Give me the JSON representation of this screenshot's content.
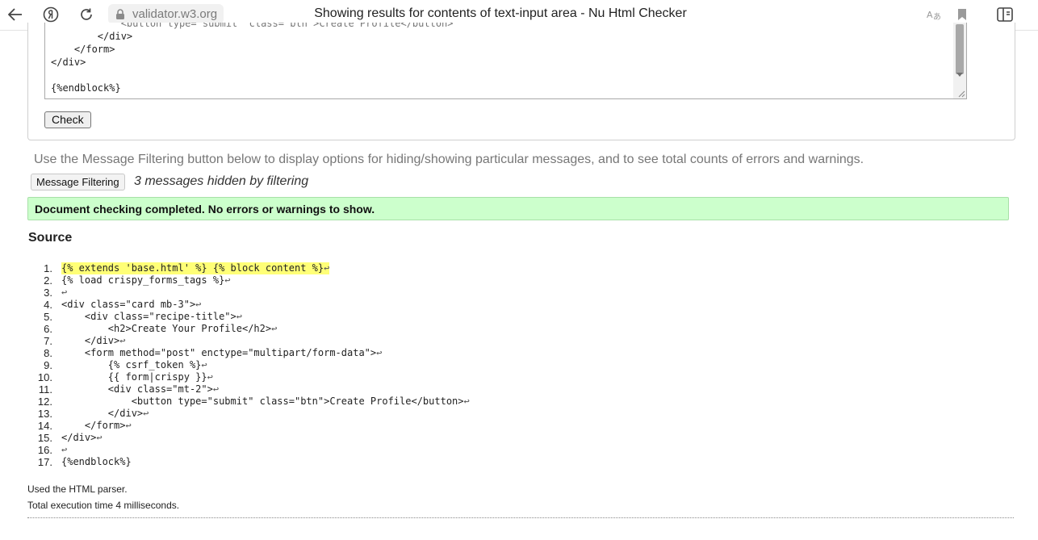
{
  "browser": {
    "url": "validator.w3.org",
    "title": "Showing results for contents of text-input area - Nu Html Checker"
  },
  "textarea": {
    "lines": [
      "            <button type=\"submit\" class=\"btn\">Create Profile</button>",
      "        </div>",
      "    </form>",
      "</div>",
      "",
      "{%endblock%}"
    ]
  },
  "form": {
    "check_label": "Check"
  },
  "filtering": {
    "hint": "Use the Message Filtering button below to display options for hiding/showing particular messages, and to see total counts of errors and warnings.",
    "button_label": "Message Filtering",
    "hidden_count": "3 messages hidden by filtering"
  },
  "result": {
    "message": "Document checking completed. No errors or warnings to show."
  },
  "source": {
    "heading": "Source",
    "lines": [
      {
        "num": "1.",
        "code": "{% extends 'base.html' %} {% block content %}",
        "highlight": true
      },
      {
        "num": "2.",
        "code": "{% load crispy_forms_tags %}",
        "highlight": false
      },
      {
        "num": "3.",
        "code": "",
        "highlight": false
      },
      {
        "num": "4.",
        "code": "<div class=\"card mb-3\">",
        "highlight": false
      },
      {
        "num": "5.",
        "code": "    <div class=\"recipe-title\">",
        "highlight": false
      },
      {
        "num": "6.",
        "code": "        <h2>Create Your Profile</h2>",
        "highlight": false
      },
      {
        "num": "7.",
        "code": "    </div>",
        "highlight": false
      },
      {
        "num": "8.",
        "code": "    <form method=\"post\" enctype=\"multipart/form-data\">",
        "highlight": false
      },
      {
        "num": "9.",
        "code": "        {% csrf_token %}",
        "highlight": false
      },
      {
        "num": "10.",
        "code": "        {{ form|crispy }}",
        "highlight": false
      },
      {
        "num": "11.",
        "code": "        <div class=\"mt-2\">",
        "highlight": false
      },
      {
        "num": "12.",
        "code": "            <button type=\"submit\" class=\"btn\">Create Profile</button>",
        "highlight": false
      },
      {
        "num": "13.",
        "code": "        </div>",
        "highlight": false
      },
      {
        "num": "14.",
        "code": "    </form>",
        "highlight": false
      },
      {
        "num": "15.",
        "code": "</div>",
        "highlight": false
      },
      {
        "num": "16.",
        "code": "",
        "highlight": false
      },
      {
        "num": "17.",
        "code": "{%endblock%}",
        "highlight": false,
        "no_eol": true
      }
    ]
  },
  "footer": {
    "parser": "Used the HTML parser.",
    "time": "Total execution time 4 milliseconds."
  },
  "colors": {
    "success_bg": "#ccffcc",
    "highlight": "#ffff77"
  }
}
